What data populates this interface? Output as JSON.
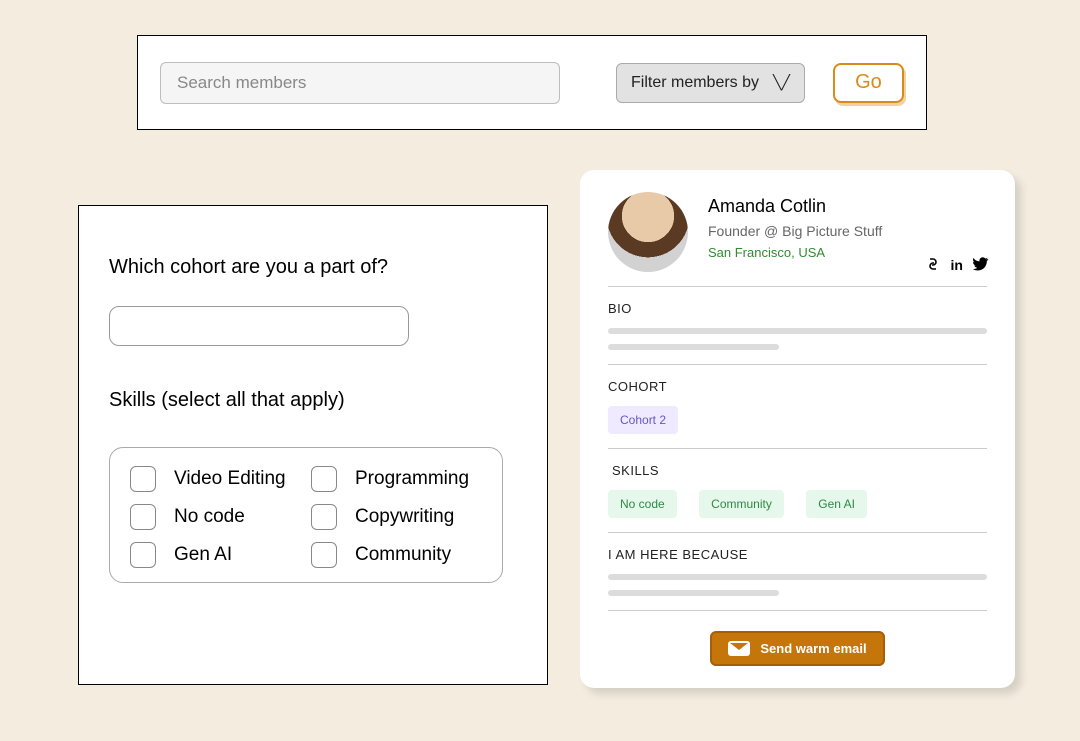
{
  "searchbar": {
    "placeholder": "Search members",
    "filter_label": "Filter members by",
    "go_label": "Go"
  },
  "form": {
    "cohort_question": "Which cohort are you a part of?",
    "skills_label": "Skills (select all that apply)",
    "skills": [
      "Video Editing",
      "Programming",
      "No code",
      "Copywriting",
      "Gen AI",
      "Community"
    ]
  },
  "profile": {
    "name": "Amanda Cotlin",
    "role": "Founder @ Big Picture Stuff",
    "location": "San Francisco, USA",
    "bio_title": "BIO",
    "cohort_title": "COHORT",
    "cohort_badge": "Cohort 2",
    "skills_title": "SKILLS",
    "skills": [
      "No code",
      "Community",
      "Gen AI"
    ],
    "here_title": "I AM HERE BECAUSE",
    "send_label": "Send warm email"
  }
}
